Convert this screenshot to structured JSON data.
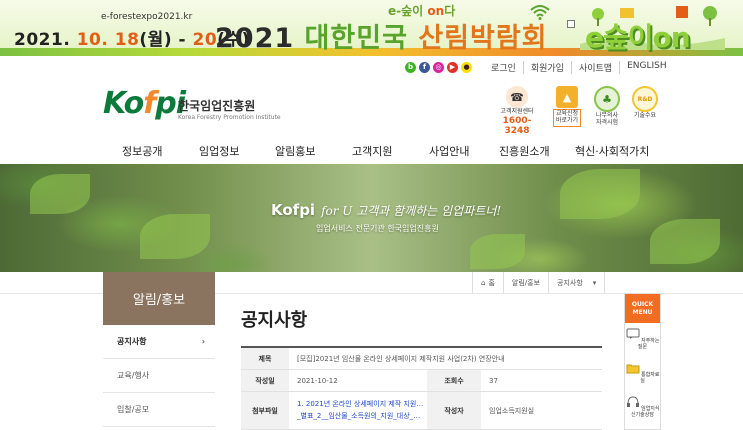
{
  "event_banner": {
    "url": "e-forestexpo2021.kr",
    "date_prefix": "2021. ",
    "date_accent_1": "10. 18",
    "date_mid": "(월) - ",
    "date_accent_2": "20",
    "date_suffix": "(수)",
    "tag_a": "e-숲이 ",
    "tag_on": "on",
    "tag_b": "다",
    "title_year": "2021 ",
    "title_green": "대한민국 ",
    "title_orange": "산림박람회",
    "logo_text": "e숲이on"
  },
  "sns": [
    {
      "icon": "blog-icon",
      "glyph": "b"
    },
    {
      "icon": "facebook-icon",
      "glyph": "f"
    },
    {
      "icon": "instagram-icon",
      "glyph": "◎"
    },
    {
      "icon": "youtube-icon",
      "glyph": "▶"
    },
    {
      "icon": "kakao-icon",
      "glyph": "●"
    }
  ],
  "util": {
    "login": "로그인",
    "join": "회원가입",
    "sitemap": "사이트맵",
    "english": "ENGLISH"
  },
  "brand": {
    "mark_a": "Ko",
    "mark_i": "f",
    "mark_b": "pi",
    "name_ko": "한국임업진흥원",
    "name_en": "Korea Forestry Promotion Institute"
  },
  "quick_icons": {
    "cs_label": "고객지원센터",
    "cs_phone": "1600-3248",
    "edu_label_1": "교육신청",
    "edu_label_2": "바로가기",
    "tree_label_1": "나무의사",
    "tree_label_2": "자격시험",
    "rd_circle": "R&D",
    "rd_label": "기술수요"
  },
  "gnb": [
    "정보공개",
    "임업정보",
    "알림홍보",
    "고객지원",
    "사업안내",
    "진흥원소개",
    "혁신·사회적가치"
  ],
  "hero": {
    "title": "Kofpi",
    "script": "for U 고객과 함께하는 임업파트너!",
    "sub": "임업서비스 전문기관 한국임업진흥원"
  },
  "lnb": {
    "title": "알림/홍보",
    "items": [
      {
        "label": "공지사항",
        "active": true
      },
      {
        "label": "교육/행사",
        "active": false
      },
      {
        "label": "입찰/공모",
        "active": false
      }
    ],
    "arrow": "›"
  },
  "breadcrumb": {
    "home": "홈",
    "level1": "알림/홍보",
    "level2": "공지사항",
    "caret": "▾"
  },
  "page_title": "공지사항",
  "board": {
    "subject_label": "제목",
    "subject": "[모집]2021년 임산물 온라인 상세페이지 제작지원 사업(2차) 연장안내",
    "date_label": "작성일",
    "date": "2021-10-12",
    "views_label": "조회수",
    "views": "37",
    "attach_label": "첨부파일",
    "attachments": [
      "1. 2021년 온라인 상세페이지 제작 지원사...",
      "_별표_2__임산물_소득원의_지원_대상_품목..."
    ],
    "author_label": "작성자",
    "author": "임업소득지원실"
  },
  "quick_menu": {
    "head_1": "QUICK",
    "head_2": "MENU",
    "items": [
      {
        "label_1": "자주하는",
        "label_2": "질문"
      },
      {
        "label_1": "통합자료실",
        "label_2": ""
      },
      {
        "label_1": "임업지식",
        "label_2": "신기술상담"
      }
    ]
  },
  "colors": {
    "brand_green": "#0b7a3b",
    "accent_orange": "#f26c24",
    "lnb_brown": "#8a735f",
    "link_blue": "#1c49c9"
  }
}
